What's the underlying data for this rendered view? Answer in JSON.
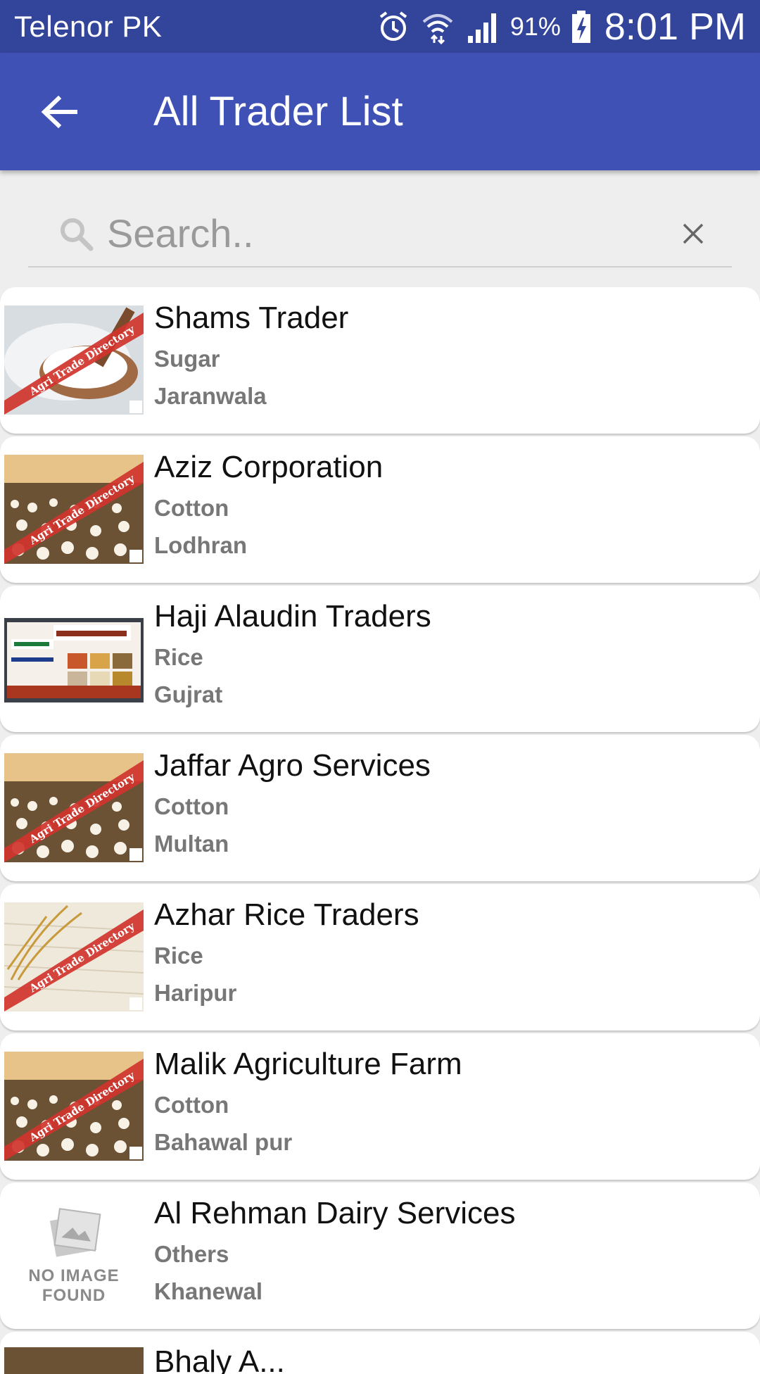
{
  "status_bar": {
    "carrier": "Telenor PK",
    "battery": "91%",
    "time": "8:01 PM",
    "icons": [
      "alarm-icon",
      "wifi-icon",
      "signal-icon",
      "battery-charging-icon"
    ]
  },
  "app_bar": {
    "title": "All Trader List",
    "back_icon": "arrow-left-icon",
    "color": "#3f51b5",
    "status_color": "#33449b"
  },
  "search": {
    "placeholder": "Search..",
    "value": ""
  },
  "traders": [
    {
      "name": "Shams Trader",
      "category": "Sugar",
      "city": "Jaranwala",
      "image": "sugar"
    },
    {
      "name": "Aziz Corporation",
      "category": "Cotton",
      "city": "Lodhran",
      "image": "cotton"
    },
    {
      "name": "Haji Alaudin Traders",
      "category": "Rice",
      "city": "Gujrat",
      "image": "card"
    },
    {
      "name": "Jaffar Agro Services",
      "category": "Cotton",
      "city": "Multan",
      "image": "cotton"
    },
    {
      "name": "Azhar Rice Traders",
      "category": "Rice",
      "city": "Haripur",
      "image": "rice"
    },
    {
      "name": "Malik Agriculture Farm",
      "category": "Cotton",
      "city": "Bahawal pur",
      "image": "cotton"
    },
    {
      "name": "Al Rehman Dairy Services",
      "category": "Others",
      "city": "Khanewal",
      "image": "none"
    }
  ],
  "thumb_banner": "Agri Trade Directory",
  "no_image": {
    "line1": "NO IMAGE",
    "line2": "FOUND"
  },
  "partial": {
    "name": "Bhaly A..."
  }
}
